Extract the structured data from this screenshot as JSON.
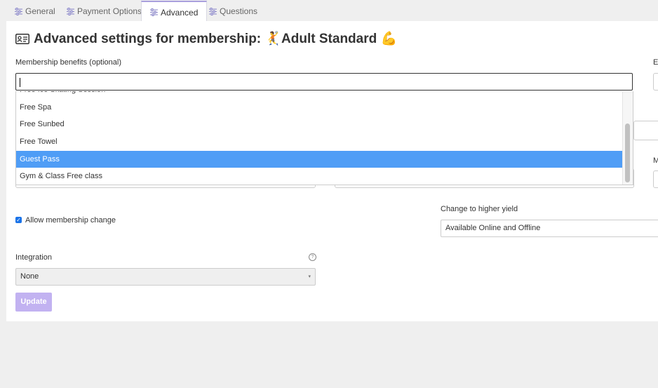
{
  "tabs": [
    {
      "label": "General"
    },
    {
      "label": "Payment Options"
    },
    {
      "label": "Advanced"
    },
    {
      "label": "Questions"
    }
  ],
  "active_tab": "Advanced",
  "page": {
    "title": "Advanced settings for membership: 🤾Adult Standard 💪"
  },
  "benefits": {
    "label": "Membership benefits (optional)",
    "input_value": "",
    "options": [
      "Free Ice Skating Session",
      "Free Spa",
      "Free Sunbed",
      "Free Towel",
      "Guest Pass",
      "Gym & Class Free class"
    ],
    "selected": "Guest Pass"
  },
  "right_clipped_labels": {
    "top": "El",
    "middle": "M"
  },
  "membership_change": {
    "label": "Allow membership change",
    "checked": true
  },
  "higher_yield": {
    "label": "Change to higher yield",
    "value": "Available Online and Offline"
  },
  "integration": {
    "label": "Integration",
    "value": "None"
  },
  "update_button": {
    "label": "Update"
  },
  "colors": {
    "selected_option": "#4f9df6",
    "update_button": "#c2b2f1",
    "active_tab_accent": "#a99fdd"
  }
}
